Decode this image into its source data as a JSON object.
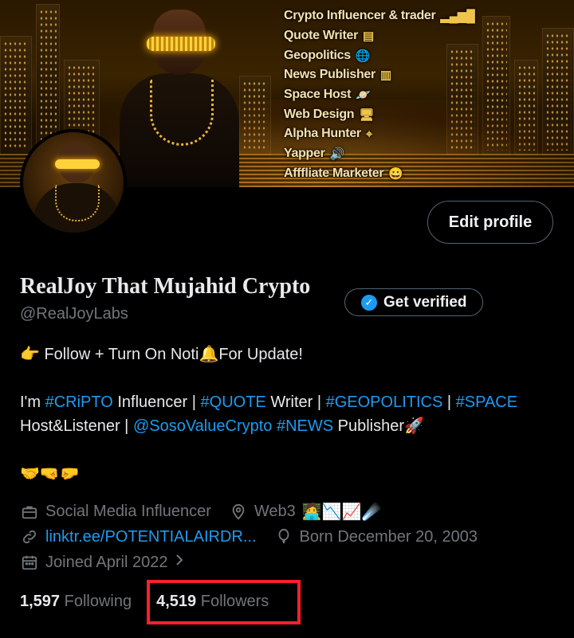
{
  "banner": {
    "skills": [
      {
        "label": "Crypto Influencer & trader",
        "icon": "chart-bars-icon",
        "glyph": "▂▄▆█"
      },
      {
        "label": "Quote Writer",
        "icon": "document-icon",
        "glyph": "▤"
      },
      {
        "label": "Geopolitics",
        "icon": "globe-icon",
        "glyph": "🌐"
      },
      {
        "label": "News Publisher",
        "icon": "newspaper-icon",
        "glyph": "▥"
      },
      {
        "label": "Space Host",
        "icon": "planet-icon",
        "glyph": "🪐"
      },
      {
        "label": "Web Design",
        "icon": "monitor-icon",
        "glyph": "🖥"
      },
      {
        "label": "Alpha Hunter",
        "icon": "crosshair-icon",
        "glyph": "⌖"
      },
      {
        "label": "Yapper",
        "icon": "speaker-icon",
        "glyph": "🔊"
      },
      {
        "label": "Afffliate Marketer",
        "icon": "smile-icon",
        "glyph": "😀"
      }
    ]
  },
  "profile": {
    "edit_label": "Edit profile",
    "display_name": "RealJoy That Mujahid Crypto",
    "verify_label": "Get verified",
    "handle": "@RealJoyLabs"
  },
  "bio": {
    "line1_emoji": "👉",
    "line1_a": "Follow + Turn On Noti",
    "line1_bell": "🔔",
    "line1_b": "For Update!",
    "l2_a": "I'm ",
    "tag_cripto": "#CRiPTO",
    "l2_b": " Influencer | ",
    "tag_quote": "#QUOTE",
    "l2_c": " Writer | ",
    "tag_geo": "#GEOPOLITICS",
    "l2_d": " | ",
    "tag_space": "#SPACE",
    "l3_a": "Host&Listener | ",
    "mention": "@SosoValueCrypto",
    "l3_b": " ",
    "tag_news": "#NEWS",
    "l3_c": " Publisher",
    "rocket": "🚀",
    "emoji_line": "🤝🤜🤛"
  },
  "meta": {
    "category": "Social Media Influencer",
    "location": "Web3",
    "location_emojis": "🧑‍💻📉📈☄️",
    "link": "linktr.ee/POTENTIALAIRDR...",
    "born": "Born December 20, 2003",
    "joined": "Joined April 2022"
  },
  "stats": {
    "following_count": "1,597",
    "following_label": "Following",
    "followers_count": "4,519",
    "followers_label": "Followers"
  },
  "colors": {
    "accent": "#1d9bf0",
    "muted": "#71767b",
    "highlight": "#ff1f2e"
  }
}
